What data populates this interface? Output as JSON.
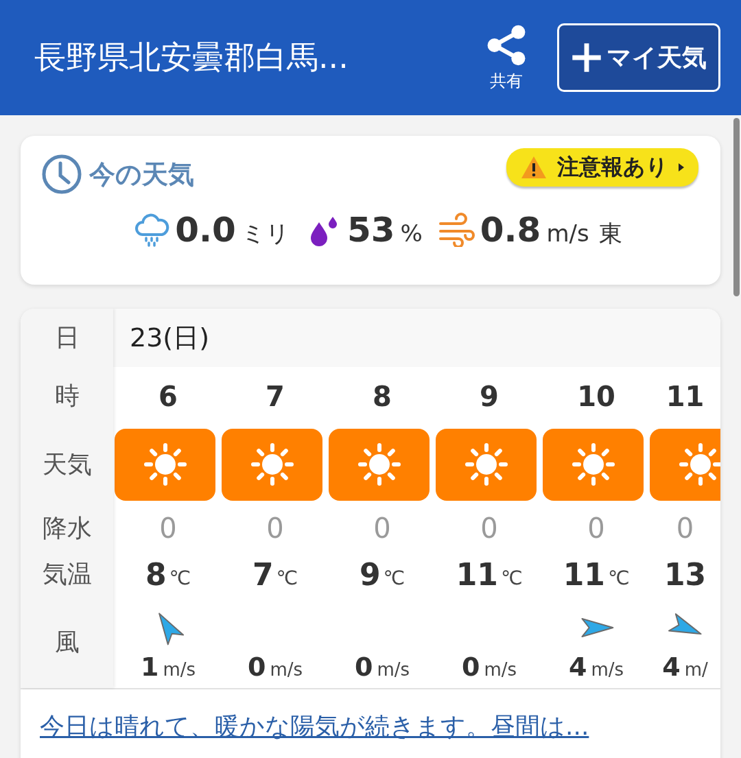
{
  "header": {
    "title": "長野県北安曇郡白馬...",
    "share_label": "共有",
    "my_weather_button": "マイ天気"
  },
  "current": {
    "title": "今の天気",
    "alert": "注意報あり",
    "precip": {
      "value": "0.0",
      "unit": "ミリ"
    },
    "humidity": {
      "value": "53",
      "unit": "%"
    },
    "wind": {
      "value": "0.8",
      "unit": "m/s",
      "direction": "東"
    }
  },
  "table": {
    "row_labels": [
      "日",
      "時",
      "天気",
      "降水",
      "気温",
      "風"
    ],
    "date": "23(日)",
    "hours": [
      {
        "hour": "6",
        "kind": "sunny",
        "precip": "0",
        "temp": "8",
        "temp_unit": "℃",
        "wind_arrow": {
          "kind": "up-left"
        },
        "wind": "1",
        "wind_unit": "m/s"
      },
      {
        "hour": "7",
        "kind": "sunny",
        "precip": "0",
        "temp": "7",
        "temp_unit": "℃",
        "wind": "0",
        "wind_unit": "m/s"
      },
      {
        "hour": "8",
        "kind": "sunny",
        "precip": "0",
        "temp": "9",
        "temp_unit": "℃",
        "wind": "0",
        "wind_unit": "m/s"
      },
      {
        "hour": "9",
        "kind": "sunny",
        "precip": "0",
        "temp": "11",
        "temp_unit": "℃",
        "wind": "0",
        "wind_unit": "m/s"
      },
      {
        "hour": "10",
        "kind": "sunny",
        "precip": "0",
        "temp": "11",
        "temp_unit": "℃",
        "wind_arrow": {
          "kind": "right"
        },
        "wind": "4",
        "wind_unit": "m/s"
      },
      {
        "hour": "11",
        "kind": "sunny",
        "precip": "0",
        "temp": "13",
        "wind_arrow": {
          "kind": "down-right"
        },
        "wind": "4",
        "wind_unit": "m/"
      }
    ]
  },
  "summary_link": "今日は晴れて、暖かな陽気が続きます。昼間は..."
}
